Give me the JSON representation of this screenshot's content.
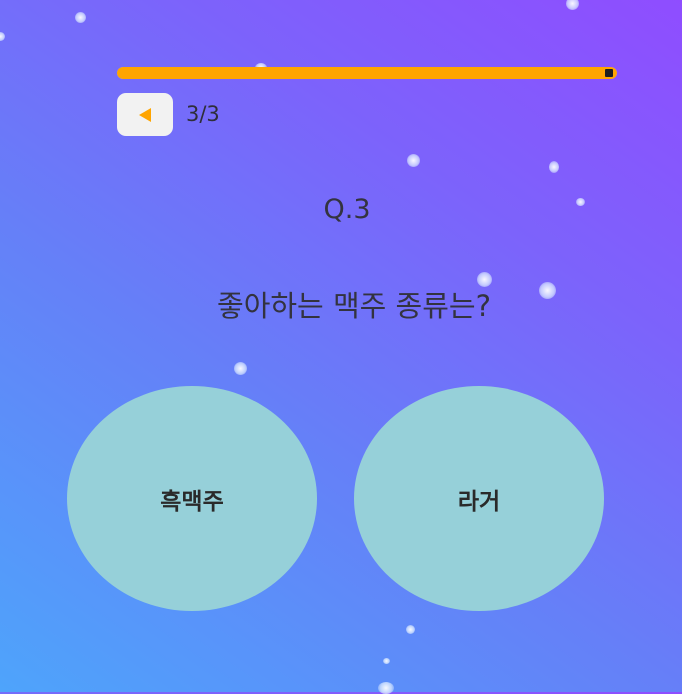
{
  "progress": {
    "fraction": 1.0,
    "fill_color": "#ffa500"
  },
  "navigation": {
    "back_icon": "triangle-left-icon",
    "counter": "3/3"
  },
  "question": {
    "number": "Q.3",
    "text": "좋아하는 맥주 종류는?"
  },
  "answers": [
    {
      "label": "흑맥주"
    },
    {
      "label": "라거"
    }
  ],
  "colors": {
    "accent": "#ffa500",
    "answer_bg": "#96d0d9",
    "back_button_bg": "#f2f2f2"
  }
}
